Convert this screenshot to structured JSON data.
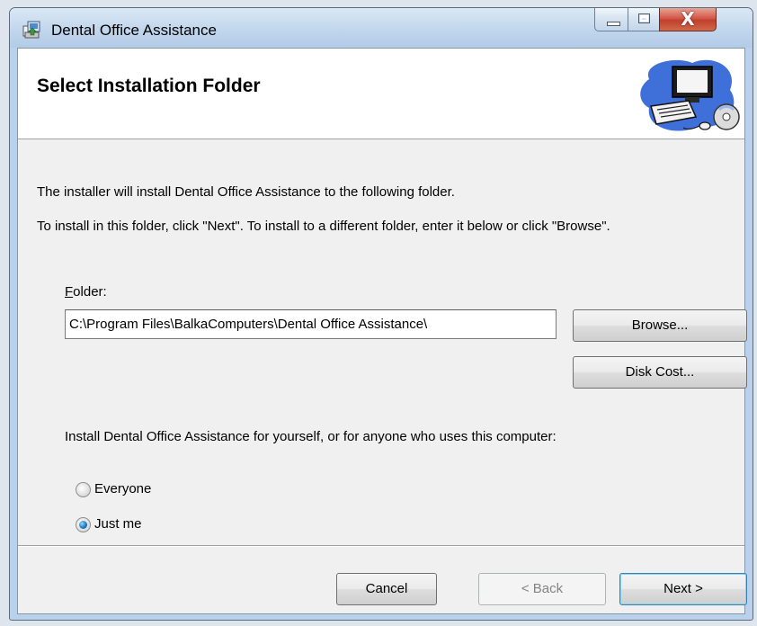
{
  "window": {
    "title": "Dental Office Assistance",
    "close_glyph": "X"
  },
  "banner": {
    "title": "Select Installation Folder",
    "art_icon": "computer-setup-icon"
  },
  "body": {
    "intro_line": "The installer will install Dental Office Assistance to the following folder.",
    "instructions_line": "To install in this folder, click \"Next\". To install to a different folder, enter it below or click \"Browse\".",
    "folder_label_accel": "F",
    "folder_label_rest": "older:",
    "folder_value": "C:\\Program Files\\BalkaComputers\\Dental Office Assistance\\",
    "browse_label": "Browse...",
    "disk_cost_label": "Disk Cost...",
    "install_for_label": "Install Dental Office Assistance for yourself, or for anyone who uses this computer:",
    "options": [
      {
        "label": "Everyone",
        "checked": false
      },
      {
        "label": "Just me",
        "checked": true
      }
    ]
  },
  "footer": {
    "cancel_label": "Cancel",
    "back_label": "< Back",
    "next_label": "Next >"
  },
  "colors": {
    "titlebar": "#bfd5ec",
    "close_button": "#c9493a",
    "dialog_background": "#f0f0f0",
    "default_button_border": "#3c7fb1"
  }
}
